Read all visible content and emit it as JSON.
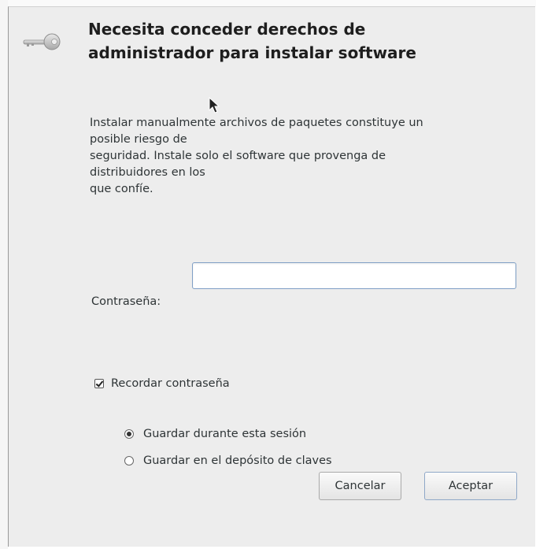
{
  "dialog": {
    "heading": "Necesita conceder derechos de\nadministrador para instalar software",
    "message": "Instalar manualmente archivos de paquetes constituye un\nposible riesgo de\nseguridad. Instale solo el software que provenga de\ndistribuidores en los\nque confíe.",
    "icon": "key-icon"
  },
  "password": {
    "label": "Contraseña:",
    "value": "",
    "placeholder": ""
  },
  "remember": {
    "label": "Recordar contraseña",
    "checked": true
  },
  "save_options": [
    {
      "label": "Guardar durante esta sesión",
      "selected": true
    },
    {
      "label": "Guardar en el depósito de claves",
      "selected": false
    }
  ],
  "buttons": {
    "cancel": "Cancelar",
    "accept": "Aceptar"
  }
}
